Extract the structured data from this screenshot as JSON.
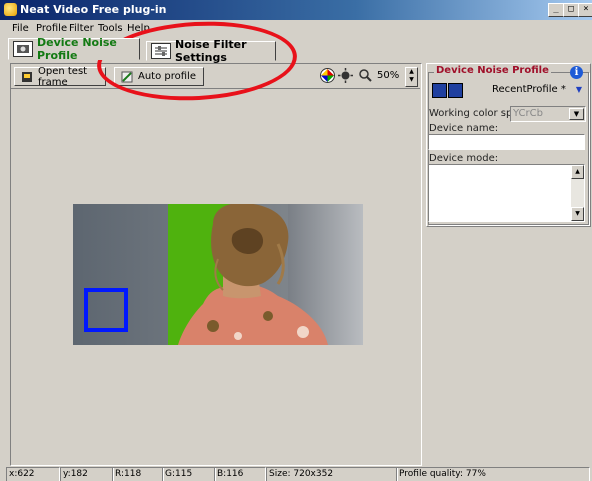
{
  "window": {
    "title": "Neat Video Free plug-in",
    "min": "_",
    "max": "□",
    "close": "×"
  },
  "menu": [
    "File",
    "Profile",
    "Filter",
    "Tools",
    "Help"
  ],
  "tabs": [
    {
      "label": "Device Noise Profile"
    },
    {
      "label": "Noise Filter Settings"
    }
  ],
  "toolbar": {
    "open_test_frame": "Open test frame",
    "auto_profile": "Auto profile",
    "zoom": "50%"
  },
  "panel": {
    "title": "Device Noise Profile",
    "info": "i",
    "profile_select": "RecentProfile *",
    "color_space_label": "Working color space:",
    "color_space_value": "YCrCb",
    "device_name_label": "Device name:",
    "device_name_value": "",
    "device_mode_label": "Device mode:",
    "device_mode_value": ""
  },
  "status": {
    "x": "x:622",
    "y": "y:182",
    "r": "R:118",
    "g": "G:115",
    "b": "B:116",
    "size": "Size: 720x352",
    "quality": "Profile quality: 77%"
  },
  "colors": {
    "title_bar": "#0a246a",
    "callout": "#e8111a",
    "selection": "#0018ff",
    "panel_title": "#a0102a"
  }
}
